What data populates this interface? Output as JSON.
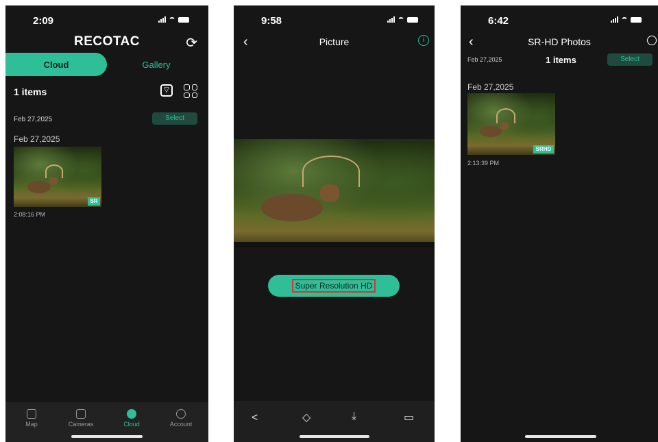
{
  "screen1": {
    "status_time": "2:09",
    "brand": "RECOTAC",
    "tabs": [
      "Cloud",
      "Gallery"
    ],
    "count": "1 items",
    "date_left": "Feb 27,2025",
    "select_label": "Select",
    "group_date": "Feb 27,2025",
    "badge": "SR",
    "photo_time": "2:08:16 PM",
    "nav": [
      "Map",
      "Cameras",
      "Cloud",
      "Account"
    ]
  },
  "screen2": {
    "status_time": "9:58",
    "title": "Picture",
    "button_label": "Super Resolution HD",
    "toolbar_icons": [
      "share-icon",
      "tag-icon",
      "download-icon",
      "trash-icon"
    ]
  },
  "screen3": {
    "status_time": "6:42",
    "title": "SR-HD Photos",
    "date_left": "Feb 27,2025",
    "count": "1 items",
    "select_label": "Select",
    "group_date": "Feb 27,2025",
    "badge": "SRHD",
    "photo_time": "2:13:39 PM"
  },
  "colors": {
    "accent": "#2fbf98",
    "dark_bg": "#161616",
    "select_bg": "#1f4a3e"
  }
}
